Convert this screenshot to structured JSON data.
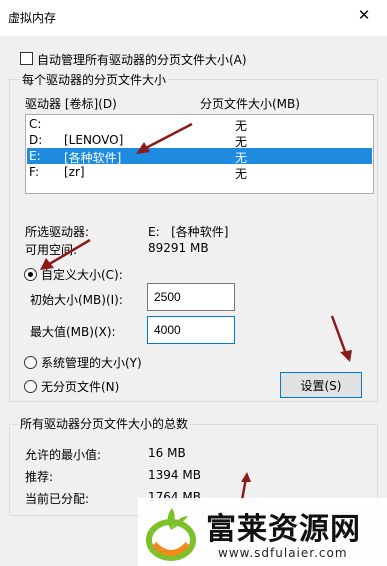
{
  "window": {
    "title": "虚拟内存",
    "close_glyph": "✕"
  },
  "auto_manage": {
    "label": "自动管理所有驱动器的分页文件大小(A)",
    "checked": false
  },
  "per_drive": {
    "group_title": "每个驱动器的分页文件大小",
    "col_drive": "驱动器 [卷标](D)",
    "col_size": "分页文件大小(MB)",
    "drives": [
      {
        "letter": "C:",
        "label": "",
        "size": "无",
        "selected": false
      },
      {
        "letter": "D:",
        "label": "[LENOVO]",
        "size": "无",
        "selected": false
      },
      {
        "letter": "E:",
        "label": "[各种软件]",
        "size": "无",
        "selected": true
      },
      {
        "letter": "F:",
        "label": "[zr]",
        "size": "无",
        "selected": false
      }
    ],
    "selected_drive_label": "所选驱动器:",
    "selected_drive_value": "E:   [各种软件]",
    "available_label": "可用空间:",
    "available_value": "89291 MB",
    "custom_size": {
      "label": "自定义大小(C):",
      "selected": true
    },
    "initial_label": "初始大小(MB)(I):",
    "initial_value": "2500",
    "max_label": "最大值(MB)(X):",
    "max_value": "4000",
    "system_managed": {
      "label": "系统管理的大小(Y)",
      "selected": false
    },
    "no_paging": {
      "label": "无分页文件(N)",
      "selected": false
    },
    "set_button": "设置(S)"
  },
  "totals": {
    "group_title": "所有驱动器分页文件大小的总数",
    "min_label": "允许的最小值:",
    "min_value": "16 MB",
    "recommended_label": "推荐:",
    "recommended_value": "1394 MB",
    "current_label": "当前已分配:",
    "current_value": "1764 MB"
  },
  "watermark": {
    "title": "富莱资源网",
    "url": "www.sdfulaier.com"
  },
  "colors": {
    "selection": "#1e8be0",
    "annotation_arrow": "#8b1a1a",
    "logo_green": "#7cc02a",
    "logo_orange": "#f08a1c"
  }
}
